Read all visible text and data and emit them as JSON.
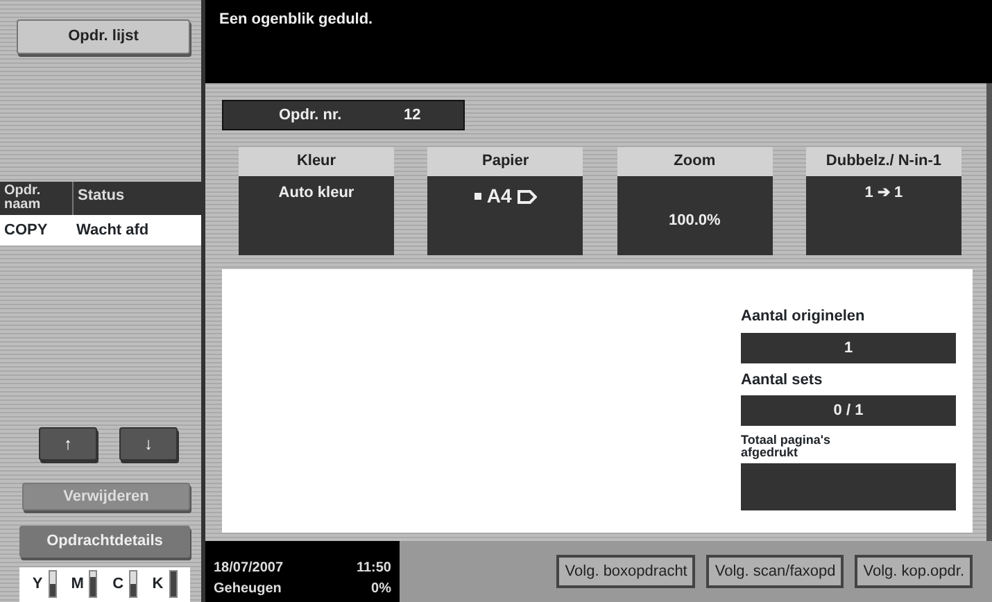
{
  "sidebar": {
    "job_list_button": "Opdr. lijst",
    "job_table": {
      "columns": [
        "Opdr. naam",
        "Status"
      ],
      "rows": [
        {
          "cells": [
            "COPY",
            "Wacht afd"
          ],
          "selected": true
        }
      ]
    },
    "scroll_buttons": [
      "↑",
      "↓"
    ],
    "delete_button": {
      "label": "Verwijderen",
      "disabled": true
    },
    "details_button": {
      "label": "Opdrachtdetails"
    },
    "toner": [
      {
        "label": "Y",
        "level": 0.5
      },
      {
        "label": "M",
        "level": 0.8
      },
      {
        "label": "C",
        "level": 0.5
      },
      {
        "label": "K",
        "level": 1.0
      }
    ]
  },
  "message": "Een ogenblik geduld.",
  "job_number": {
    "label": "Opdr. nr.",
    "value": "12"
  },
  "settings": [
    {
      "label": "Kleur",
      "value": "Auto kleur",
      "kind": "text"
    },
    {
      "label": "Papier",
      "value": "A4",
      "kind": "paper"
    },
    {
      "label": "Zoom",
      "value": "100.0%",
      "kind": "low"
    },
    {
      "label": "Dubbelz./ N-in-1",
      "value": "1 ➔ 1",
      "kind": "text"
    }
  ],
  "counters": [
    {
      "label": "Aantal originelen",
      "value": "1"
    },
    {
      "label": "Aantal sets",
      "value": "0 / 1"
    },
    {
      "label": "Totaal pagina's afgedrukt",
      "tall": true
    }
  ],
  "status_bar": {
    "date": "18/07/2007",
    "time": "11:50",
    "memory_label": "Geheugen",
    "memory": "0%"
  },
  "bottom_buttons": [
    "Volg. boxopdracht",
    "Volg. scan/faxopd",
    "Volg. kop.opdr."
  ]
}
